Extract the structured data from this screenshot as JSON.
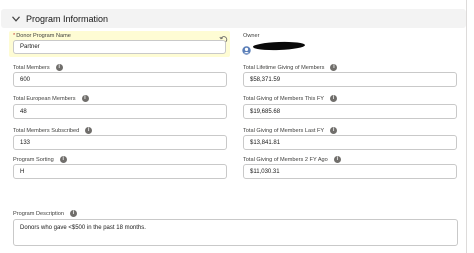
{
  "section": {
    "title": "Program Information",
    "chevron_icon": "chevron-down-icon"
  },
  "left_fields": [
    {
      "label": "Donor Program Name",
      "value": "Partner",
      "required": true,
      "highlighted": true
    },
    {
      "label": "Total Members",
      "value": "600"
    },
    {
      "label": "Total European Members",
      "value": "48"
    },
    {
      "label": "Total Members Subscribed",
      "value": "133"
    },
    {
      "label": "Program Sorting",
      "value": "H"
    }
  ],
  "right_fields": [
    {
      "label": "Owner",
      "value": ""
    },
    {
      "label": "Total Lifetime Giving of Members",
      "value": "$58,371.59"
    },
    {
      "label": "Total Giving of Members This FY",
      "value": "$19,685.68"
    },
    {
      "label": "Total Giving of Members Last FY",
      "value": "$13,841.81"
    },
    {
      "label": "Total Giving of Members 2 FY Ago",
      "value": "$11,030.31"
    }
  ],
  "description": {
    "label": "Program Description",
    "value": "Donors who gave <$500 in the past 18 months."
  },
  "required_marker": "*",
  "info_glyph": "i",
  "colors": {
    "header_bg": "#f3f3f3",
    "highlight_bg": "#fefcd4",
    "info_icon": "#706e6b",
    "border": "#c9c9c9",
    "required": "#c23934"
  }
}
